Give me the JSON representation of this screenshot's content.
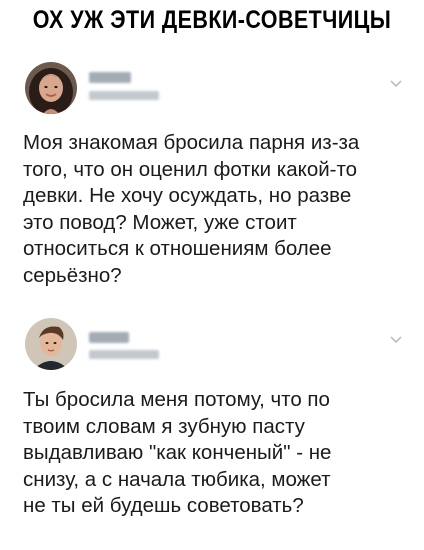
{
  "header": {
    "title": "ОХ УЖ ЭТИ ДЕВКИ-СОВЕТЧИЦЫ"
  },
  "posts": [
    {
      "lines": [
        "Моя знакомая бросила парня из-за",
        "того, что он оценил фотки какой-то",
        "девки. Не хочу осуждать, но разве",
        "это повод? Может, уже стоит",
        "относиться к отношениям более",
        "серьёзно?"
      ],
      "icons": {
        "avatar": "female-avatar",
        "menu": "chevron-down-icon"
      }
    },
    {
      "lines": [
        "Ты бросила меня потому, что по",
        "твоим словам я зубную пасту",
        "выдавливаю \"как конченый\" - не",
        "снизу, а с начала тюбика, может",
        "не ты ей будешь советовать?"
      ],
      "icons": {
        "avatar": "male-avatar",
        "menu": "chevron-down-icon"
      }
    }
  ],
  "colors": {
    "background": "#ffffff",
    "text": "#1b1b1b",
    "blurred_name": "#9aa3ad",
    "chevron": "#b8bfc6"
  }
}
